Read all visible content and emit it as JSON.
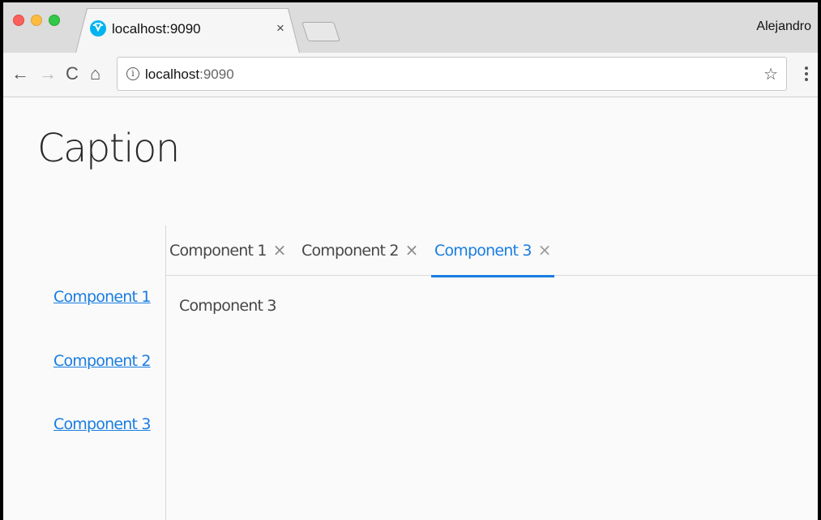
{
  "browser": {
    "tab": {
      "title": "localhost:9090",
      "close_glyph": "×",
      "favicon": "vaadin-logo-icon"
    },
    "profile_name": "Alejandro",
    "toolbar": {
      "back_glyph": "←",
      "forward_glyph": "→",
      "reload_glyph": "C",
      "home_glyph": "⌂",
      "url_host": "localhost",
      "url_port": ":9090",
      "info_glyph": "i",
      "star_glyph": "☆"
    }
  },
  "page": {
    "caption": "Caption",
    "sidebar": {
      "links": [
        {
          "label": "Component 1"
        },
        {
          "label": "Component 2"
        },
        {
          "label": "Component 3"
        }
      ]
    },
    "tabsheet": {
      "tabs": [
        {
          "label": "Component 1",
          "close": "×",
          "selected": false
        },
        {
          "label": "Component 2",
          "close": "×",
          "selected": false
        },
        {
          "label": "Component 3",
          "close": "×",
          "selected": true
        }
      ],
      "content": "Component 3"
    },
    "colors": {
      "accent": "#197de1",
      "text": "#474747",
      "background": "#fafafa"
    }
  }
}
